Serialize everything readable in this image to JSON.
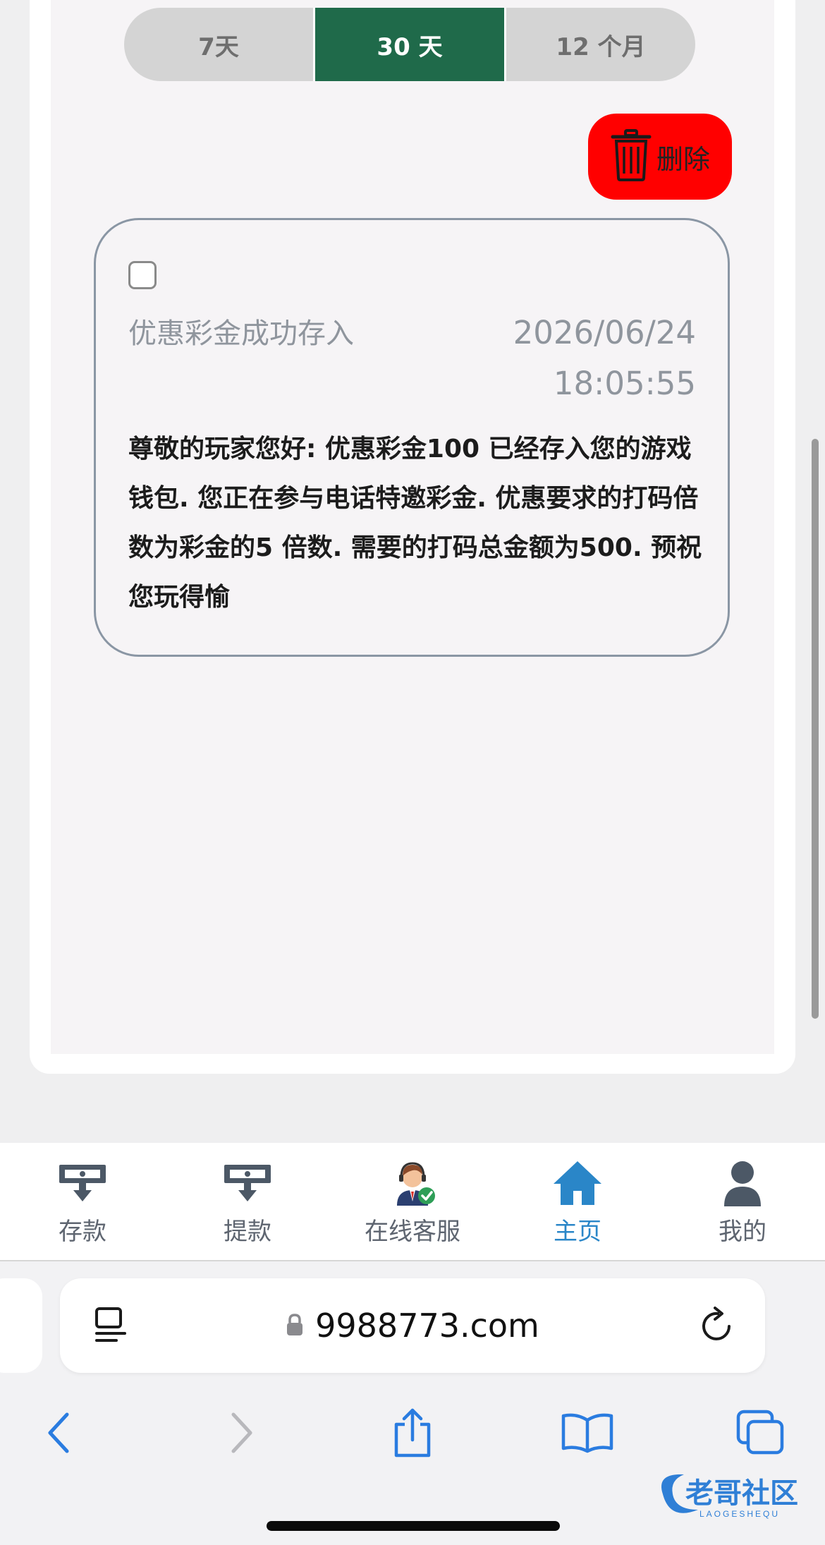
{
  "filters": {
    "opt1": "7天",
    "opt2": "30 天",
    "opt3": "12 个月",
    "active": "30 天"
  },
  "delete_button": {
    "label": "删除"
  },
  "message": {
    "title": "优惠彩金成功存入",
    "date": "2026/06/24",
    "time": "18:05:55",
    "body": "尊敬的玩家您好: 优惠彩金100 已经存入您的游戏钱包. 您正在参与电话特邀彩金. 优惠要求的打码倍数为彩金的5 倍数. 需要的打码总金额为500. 预祝您玩得愉"
  },
  "bottom_nav": {
    "deposit": "存款",
    "withdraw": "提款",
    "support": "在线客服",
    "home": "主页",
    "mine": "我的",
    "active": "主页"
  },
  "browser": {
    "url": "9988773.com"
  },
  "watermark": {
    "text": "老哥社区",
    "sub": "LAOGESHEQU"
  },
  "colors": {
    "accent_green": "#1f6a4a",
    "delete_red": "#ff0000",
    "nav_active": "#2a86c8",
    "safari_blue": "#2a7ce0"
  }
}
